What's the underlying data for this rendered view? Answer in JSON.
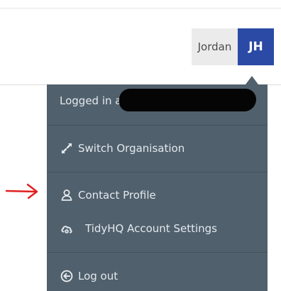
{
  "header": {
    "user_name": "Jordan",
    "avatar_initials": "JH"
  },
  "menu": {
    "logged_in_prefix": "Logged in a",
    "switch_org": "Switch Organisation",
    "contact_profile": "Contact Profile",
    "account_settings": "TidyHQ Account Settings",
    "log_out": "Log out"
  },
  "icons": {
    "switch_org": "expand-arrows-icon",
    "contact_profile": "user-outline-icon",
    "account_settings": "cloud-gear-icon",
    "log_out": "circle-arrow-left-icon"
  },
  "colors": {
    "menu_bg": "#50606c",
    "avatar_bg": "#2b4aa6",
    "annotation": "#e02020"
  }
}
